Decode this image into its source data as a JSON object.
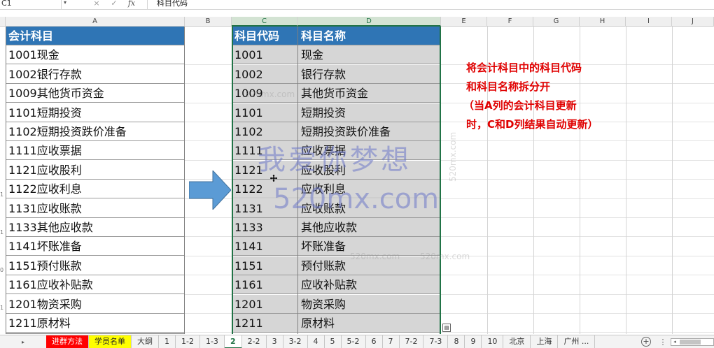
{
  "formula_bar": {
    "name_box": "C1",
    "cancel_icon": "×",
    "enter_icon": "✓",
    "fx_label": "fx",
    "content": "科目代码"
  },
  "columns": [
    "A",
    "B",
    "C",
    "D",
    "E",
    "F",
    "G",
    "H",
    "I",
    "J"
  ],
  "row_fragments": [
    "1",
    "1",
    "0",
    "1"
  ],
  "col_a": {
    "header": "会计科目",
    "rows": [
      "1001现金",
      "1002银行存款",
      "1009其他货币资金",
      "1101短期投资",
      "1102短期投资跌价准备",
      "1111应收票据",
      "1121应收股利",
      "1122应收利息",
      "1131应收账款",
      "1133其他应收款",
      "1141坏账准备",
      "1151预付账款",
      "1161应收补贴款",
      "1201物资采购",
      "1211原材料"
    ]
  },
  "col_c": {
    "header": "科目代码",
    "rows": [
      "1001",
      "1002",
      "1009",
      "1101",
      "1102",
      "1111",
      "1121",
      "1122",
      "1131",
      "1133",
      "1141",
      "1151",
      "1161",
      "1201",
      "1211"
    ]
  },
  "col_d": {
    "header": "科目名称",
    "rows": [
      "现金",
      "银行存款",
      "其他货币资金",
      "短期投资",
      "短期投资跌价准备",
      "应收票据",
      "应收股利",
      "应收利息",
      "应收账款",
      "其他应收款",
      "坏账准备",
      "预付账款",
      "应收补贴款",
      "物资采购",
      "原材料"
    ]
  },
  "note": {
    "lines": [
      "将会计科目中的科目代码",
      "和科目名称拆分开",
      "（当A列的会计科目更新",
      "时，C和D列结果自动更新）"
    ],
    "color": "#e00000"
  },
  "watermarks": {
    "main_text": "我爱你梦想",
    "domain_large": "520mx.com",
    "domain_small": "520mx.com"
  },
  "tabs": [
    {
      "label": "进群方法",
      "style": "red"
    },
    {
      "label": "学员名单",
      "style": "yellow"
    },
    {
      "label": "大纲",
      "style": ""
    },
    {
      "label": "1",
      "style": ""
    },
    {
      "label": "1-2",
      "style": ""
    },
    {
      "label": "1-3",
      "style": ""
    },
    {
      "label": "2",
      "style": "active"
    },
    {
      "label": "2-2",
      "style": ""
    },
    {
      "label": "3",
      "style": ""
    },
    {
      "label": "3-2",
      "style": ""
    },
    {
      "label": "4",
      "style": ""
    },
    {
      "label": "5",
      "style": ""
    },
    {
      "label": "5-2",
      "style": ""
    },
    {
      "label": "6",
      "style": ""
    },
    {
      "label": "7",
      "style": ""
    },
    {
      "label": "7-2",
      "style": ""
    },
    {
      "label": "7-3",
      "style": ""
    },
    {
      "label": "8",
      "style": ""
    },
    {
      "label": "9",
      "style": ""
    },
    {
      "label": "10",
      "style": ""
    },
    {
      "label": "北京",
      "style": ""
    },
    {
      "label": "上海",
      "style": ""
    },
    {
      "label": "广州 ...",
      "style": ""
    }
  ],
  "tab_nav": "▸",
  "add_sheet": "+",
  "more_tabs": "⋮",
  "colors": {
    "header_blue": "#2f75b5",
    "selection_green": "#217346",
    "arrow_blue": "#5b9bd5"
  }
}
